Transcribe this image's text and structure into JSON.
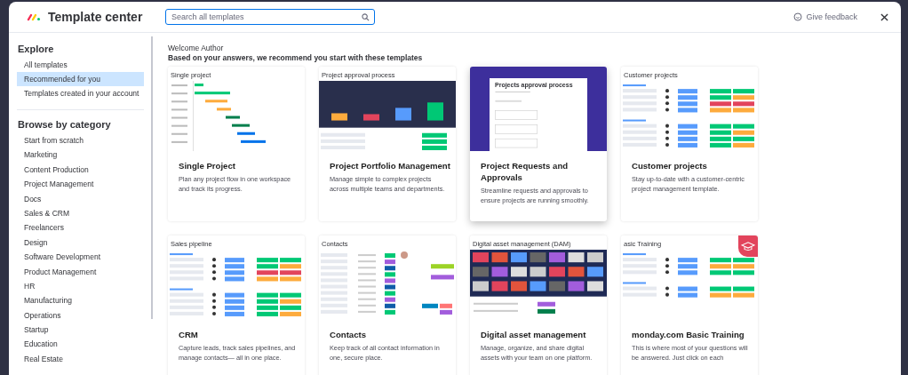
{
  "header": {
    "title": "Template center",
    "search": {
      "placeholder": "Search all templates"
    },
    "feedback": "Give feedback"
  },
  "sidebar": {
    "explore_heading": "Explore",
    "explore_items": [
      {
        "label": "All templates",
        "selected": false
      },
      {
        "label": "Recommended for you",
        "selected": true
      },
      {
        "label": "Templates created in your account",
        "selected": false
      }
    ],
    "category_heading": "Browse by category",
    "categories": [
      "Start from scratch",
      "Marketing",
      "Content Production",
      "Project Management",
      "Docs",
      "Sales & CRM",
      "Freelancers",
      "Design",
      "Software Development",
      "Product Management",
      "HR",
      "Manufacturing",
      "Operations",
      "Startup",
      "Education",
      "Real Estate"
    ]
  },
  "main": {
    "greeting": "Welcome Author",
    "heading": "Based on your answers, we recommend you start with these templates",
    "templates": [
      {
        "kind": "gantt",
        "preview_title": "Single project",
        "title": "Single Project",
        "description": "Plan any project flow in one workspace and track its progress.",
        "hovered": false
      },
      {
        "kind": "chart",
        "preview_title": "Project approval process",
        "title": "Project Portfolio Management",
        "description": "Manage simple to complex projects across multiple teams and departments.",
        "hovered": false
      },
      {
        "kind": "form",
        "preview_title": "Projects approval process",
        "title": "Project Requests and Approvals",
        "description": "Streamline requests and approvals to ensure projects are running smoothly.",
        "hovered": true
      },
      {
        "kind": "table",
        "preview_title": "Customer projects",
        "title": "Customer projects",
        "description": "Stay up-to-date with a customer-centric project management template.",
        "hovered": false
      },
      {
        "kind": "table",
        "preview_title": "Sales pipeline",
        "title": "CRM",
        "description": "Capture leads, track sales pipelines, and manage contacts— all in one place.",
        "hovered": false
      },
      {
        "kind": "contacts",
        "preview_title": "Contacts",
        "title": "Contacts",
        "description": "Keep track of all contact information in one, secure place.",
        "hovered": false
      },
      {
        "kind": "gallery",
        "preview_title": "Digital asset management (DAM)",
        "title": "Digital asset management",
        "description": "Manage, organize, and share digital assets with your team on one platform.",
        "hovered": false
      },
      {
        "kind": "training",
        "preview_title": "asic Training",
        "title": "monday.com Basic Training",
        "description": "This is where most of your questions will be answered. Just click on each",
        "hovered": false
      }
    ]
  }
}
